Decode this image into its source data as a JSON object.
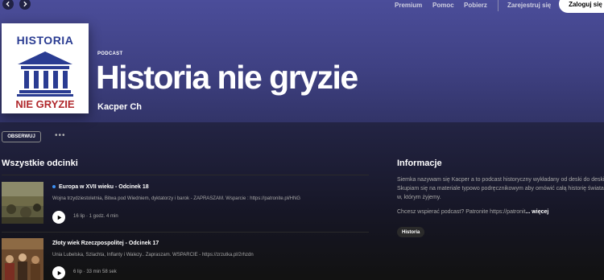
{
  "topbar": {
    "links": [
      "Premium",
      "Pomoc",
      "Pobierz"
    ],
    "signup": "Zarejestruj się",
    "login": "Zaloguj się"
  },
  "podcast": {
    "type": "PODCAST",
    "title": "Historia nie gryzie",
    "author": "Kacper Ch",
    "cover_top_text": "HISTORIA",
    "cover_bottom_text": "NIE GRYZIE"
  },
  "actions": {
    "follow": "OBSERWUJ",
    "more": "•••"
  },
  "episodes_section": {
    "title": "Wszystkie odcinki",
    "episodes": [
      {
        "title": "Europa w XVII wieku - Odcinek 18",
        "description": "Wojna trzydziestoletnia, Bitwa pod Wiedniem, dyktatorzy i barok - ZAPRASZAM. Wsparcie : https://patronite.pl/HNG",
        "meta": "16 lip · 1 godz. 4 min",
        "is_new": true
      },
      {
        "title": "Złoty wiek Rzeczpospolitej - Odcinek 17",
        "description": "Unia Lubelska,   Szlachta, Inflanty i  Walezy..  Zapraszam. WSPARCIE - https://zrzutka.pl/2rhzdn",
        "meta": "6 lip · 33 min 58 sek",
        "is_new": false
      }
    ]
  },
  "info": {
    "title": "Informacje",
    "description": "Siemka nazywam się Kacper a to podcast historyczny wykładany od deski do deski. Skupiam się na materiale typowo podręcznikowym aby omówić całą historię świata w, którym żyjemy.",
    "question": "Chcesz wspierać podcast? Patronite https://patronit",
    "more": "... więcej",
    "tag": "Historia"
  },
  "colors": {
    "hero": "#4b4d9a",
    "background": "#121212",
    "cover_blue": "#2a3c92",
    "cover_red": "#b0282c",
    "new_dot": "#3d91f4"
  },
  "icons": {
    "back": "chevron-left-icon",
    "forward": "chevron-right-icon",
    "play": "play-icon",
    "more": "more-dots-icon"
  }
}
